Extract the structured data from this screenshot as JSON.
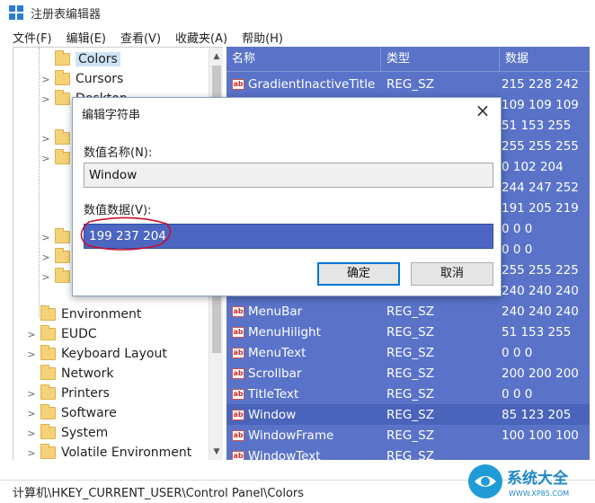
{
  "window": {
    "title": "注册表编辑器"
  },
  "menu": [
    "文件(F)",
    "编辑(E)",
    "查看(V)",
    "收藏夹(A)",
    "帮助(H)"
  ],
  "tree": {
    "items": [
      {
        "label": "Colors",
        "indent": 2,
        "chevron": "",
        "selected": true
      },
      {
        "label": "Cursors",
        "indent": 2,
        "chevron": ">"
      },
      {
        "label": "Desktop",
        "indent": 2,
        "chevron": ">"
      },
      {
        "label": "Environment",
        "indent": 1,
        "chevron": ""
      },
      {
        "label": "EUDC",
        "indent": 1,
        "chevron": ">"
      },
      {
        "label": "Keyboard Layout",
        "indent": 1,
        "chevron": ">"
      },
      {
        "label": "Network",
        "indent": 1,
        "chevron": ""
      },
      {
        "label": "Printers",
        "indent": 1,
        "chevron": ">"
      },
      {
        "label": "Software",
        "indent": 1,
        "chevron": ">"
      },
      {
        "label": "System",
        "indent": 1,
        "chevron": ">"
      },
      {
        "label": "Volatile Environment",
        "indent": 1,
        "chevron": ">"
      }
    ]
  },
  "list": {
    "columns": [
      "名称",
      "类型",
      "数据"
    ],
    "rows": [
      {
        "name": "GradientInactiveTitle",
        "type": "REG_SZ",
        "data": "215 228 242"
      },
      {
        "name": "",
        "type": "",
        "data": "109 109 109"
      },
      {
        "name": "",
        "type": "",
        "data": "51 153 255"
      },
      {
        "name": "",
        "type": "",
        "data": "255 255 255"
      },
      {
        "name": "",
        "type": "",
        "data": "0 102 204"
      },
      {
        "name": "",
        "type": "",
        "data": "244 247 252"
      },
      {
        "name": "",
        "type": "",
        "data": "191 205 219"
      },
      {
        "name": "",
        "type": "",
        "data": "0 0 0"
      },
      {
        "name": "",
        "type": "",
        "data": "0 0 0"
      },
      {
        "name": "",
        "type": "",
        "data": "255 255 225"
      },
      {
        "name": "",
        "type": "",
        "data": "240 240 240"
      },
      {
        "name": "MenuBar",
        "type": "REG_SZ",
        "data": "240 240 240"
      },
      {
        "name": "MenuHilight",
        "type": "REG_SZ",
        "data": "51 153 255"
      },
      {
        "name": "MenuText",
        "type": "REG_SZ",
        "data": "0 0 0"
      },
      {
        "name": "Scrollbar",
        "type": "REG_SZ",
        "data": "200 200 200"
      },
      {
        "name": "TitleText",
        "type": "REG_SZ",
        "data": "0 0 0"
      },
      {
        "name": "Window",
        "type": "REG_SZ",
        "data": "85 123 205",
        "selected": true
      },
      {
        "name": "WindowFrame",
        "type": "REG_SZ",
        "data": "100 100 100"
      },
      {
        "name": "WindowText",
        "type": "REG_SZ",
        "data": ""
      }
    ]
  },
  "dialog": {
    "title": "编辑字符串",
    "name_label": "数值名称(N):",
    "name_value": "Window",
    "data_label": "数值数据(V):",
    "data_value": "199 237 204",
    "ok": "确定",
    "cancel": "取消"
  },
  "status": {
    "path": "计算机\\HKEY_CURRENT_USER\\Control Panel\\Colors"
  },
  "watermark": {
    "brand": "系统大全",
    "url": "WWW.XP85.COM"
  },
  "colors": {
    "list_bg": "#5a73c9",
    "selection": "#4c66c2",
    "accent": "#0078d7",
    "annotation": "#c8102e"
  }
}
